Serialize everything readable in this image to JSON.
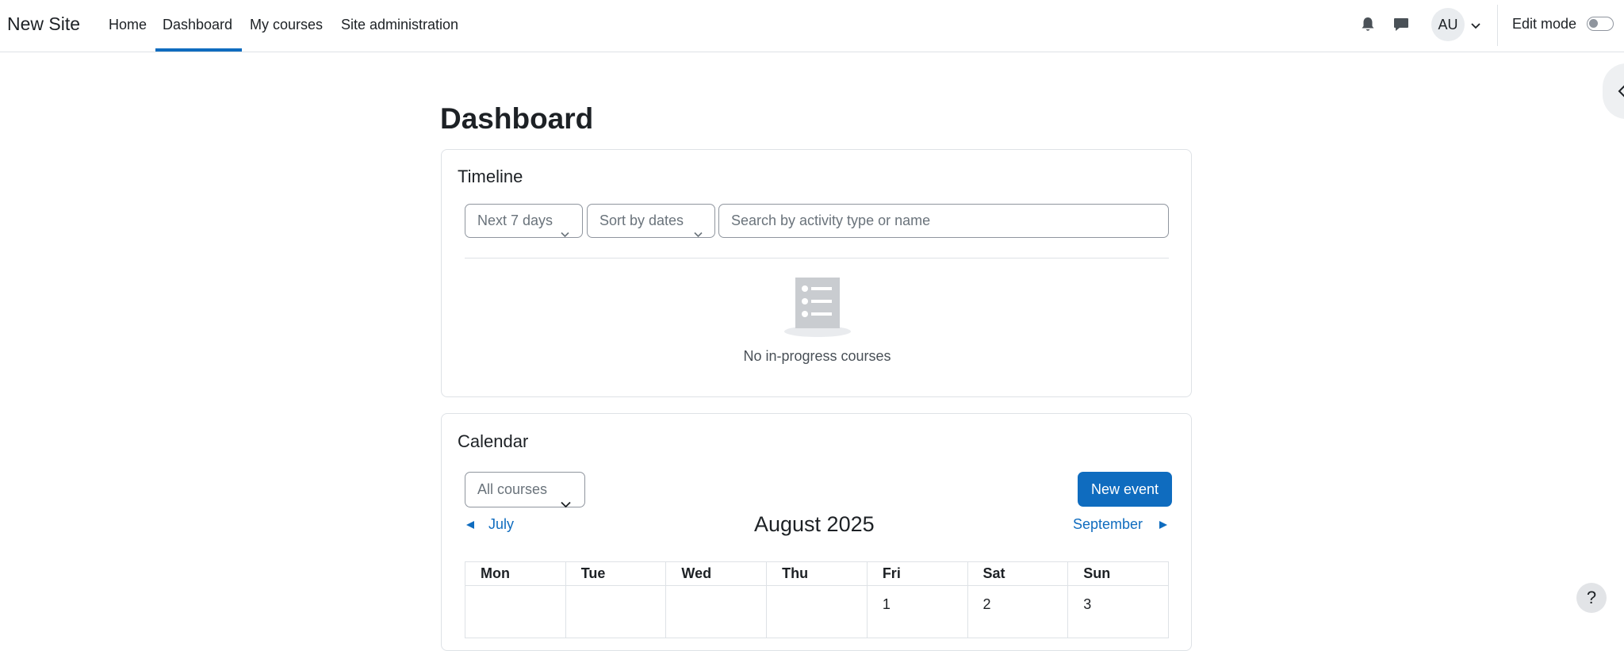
{
  "navbar": {
    "brand": "New Site",
    "links": [
      {
        "label": "Home"
      },
      {
        "label": "Dashboard",
        "active": true
      },
      {
        "label": "My courses"
      },
      {
        "label": "Site administration"
      }
    ],
    "user_initials": "AU",
    "edit_mode_label": "Edit mode",
    "edit_mode_on": false,
    "icons": [
      "bell-icon",
      "chat-icon",
      "chevron-down-icon"
    ]
  },
  "page": {
    "title": "Dashboard"
  },
  "timeline": {
    "title": "Timeline",
    "filter_label": "Next 7 days",
    "sort_label": "Sort by dates",
    "search_placeholder": "Search by activity type or name",
    "empty_text": "No in-progress courses"
  },
  "calendar": {
    "title": "Calendar",
    "course_filter": "All courses",
    "new_event_label": "New event",
    "prev_month": "July",
    "next_month": "September",
    "current_month": "August 2025",
    "weekdays": [
      "Mon",
      "Tue",
      "Wed",
      "Thu",
      "Fri",
      "Sat",
      "Sun"
    ],
    "first_week": [
      "",
      "",
      "",
      "",
      "1",
      "2",
      "3"
    ]
  },
  "help": {
    "label": "?"
  },
  "colors": {
    "accent": "#0f6cbf",
    "border": "#dee2e6",
    "text": "#1d2125",
    "muted": "#6a737b"
  }
}
